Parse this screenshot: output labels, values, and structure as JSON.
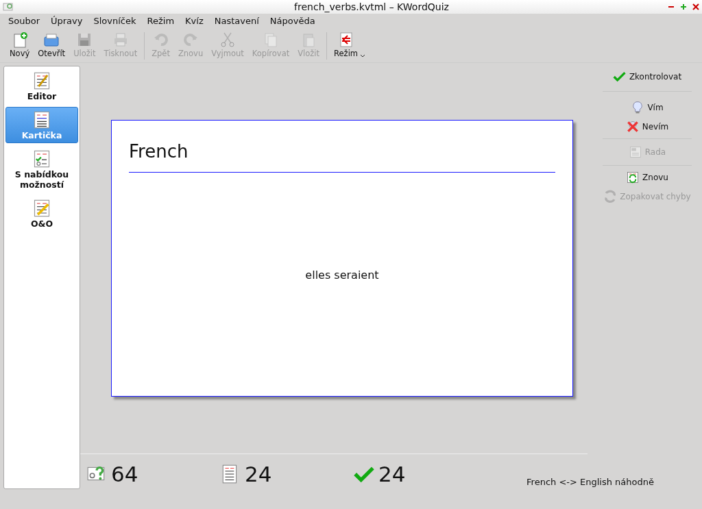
{
  "window": {
    "title": "french_verbs.kvtml – KWordQuiz"
  },
  "menu": [
    "Soubor",
    "Úpravy",
    "Slovníček",
    "Režim",
    "Kvíz",
    "Nastavení",
    "Nápověda"
  ],
  "toolbar": [
    {
      "label": "Nový",
      "disabled": false
    },
    {
      "label": "Otevřít",
      "disabled": false
    },
    {
      "label": "Uložit",
      "disabled": true
    },
    {
      "label": "Tisknout",
      "disabled": true
    },
    {
      "label": "Zpět",
      "disabled": true
    },
    {
      "label": "Znovu",
      "disabled": true
    },
    {
      "label": "Vyjmout",
      "disabled": true
    },
    {
      "label": "Kopírovat",
      "disabled": true
    },
    {
      "label": "Vložit",
      "disabled": true
    },
    {
      "label": "Režim",
      "disabled": false
    }
  ],
  "sidebar": {
    "items": [
      {
        "label": "Editor",
        "selected": false
      },
      {
        "label": "Kartička",
        "selected": true
      },
      {
        "label": "S nabídkou možností",
        "selected": false
      },
      {
        "label": "O&O",
        "selected": false
      }
    ]
  },
  "card": {
    "heading": "French",
    "word": "elles seraient"
  },
  "actions": [
    {
      "label": "Zkontrolovat",
      "disabled": false
    },
    {
      "label": "Vím",
      "disabled": false
    },
    {
      "label": "Nevím",
      "disabled": false
    },
    {
      "label": "Rada",
      "disabled": true
    },
    {
      "label": "Znovu",
      "disabled": false
    },
    {
      "label": "Zopakovat chyby",
      "disabled": true
    }
  ],
  "stats": [
    "64",
    "24",
    "24"
  ],
  "status_bar": "French <-> English náhodně"
}
